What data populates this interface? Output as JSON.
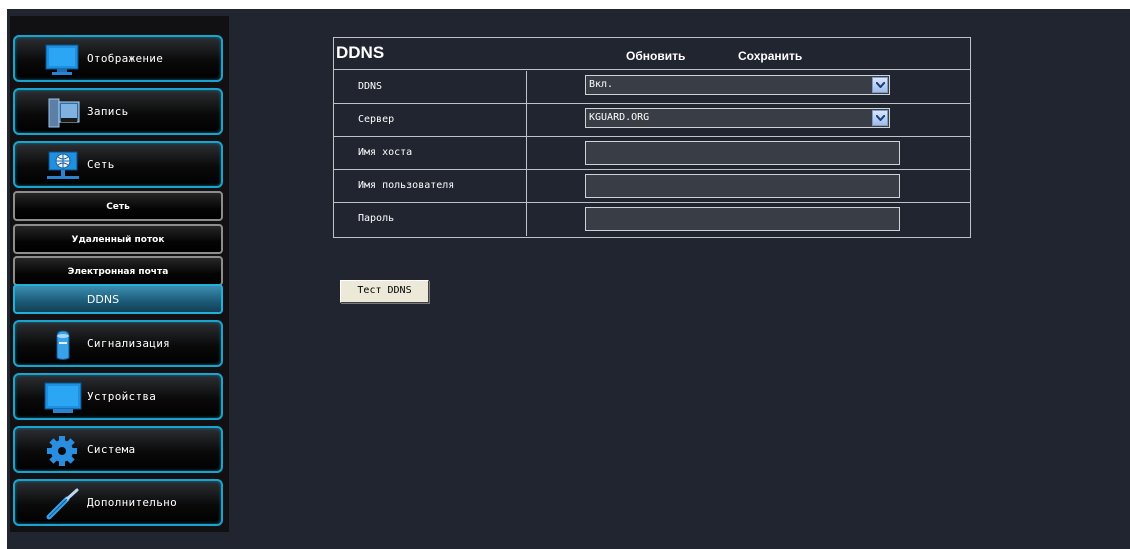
{
  "sidebar": {
    "items": [
      {
        "label": "Отображение",
        "icon": "monitor-icon"
      },
      {
        "label": "Запись",
        "icon": "film-icon"
      },
      {
        "label": "Сеть",
        "icon": "network-icon"
      },
      {
        "label": "Сигнализация",
        "icon": "alarm-icon"
      },
      {
        "label": "Устройства",
        "icon": "devices-icon"
      },
      {
        "label": "Система",
        "icon": "gear-icon"
      },
      {
        "label": "Дополнительно",
        "icon": "wrench-icon"
      }
    ],
    "subitems": [
      {
        "label": "Сеть"
      },
      {
        "label": "Удаленный поток"
      },
      {
        "label": "Электронная почта"
      },
      {
        "label": "DDNS",
        "active": true
      }
    ]
  },
  "main": {
    "title": "DDNS",
    "refresh_label": "Обновить",
    "save_label": "Сохранить",
    "rows": [
      {
        "label": "DDNS",
        "type": "select",
        "value": "Вкл."
      },
      {
        "label": "Сервер",
        "type": "select",
        "value": "KGUARD.ORG"
      },
      {
        "label": "Имя хоста",
        "type": "text",
        "value": ""
      },
      {
        "label": "Имя пользователя",
        "type": "text",
        "value": ""
      },
      {
        "label": "Пароль",
        "type": "password",
        "value": ""
      }
    ],
    "test_button_label": "Тест DDNS"
  },
  "colors": {
    "background": "#202530",
    "accent": "#1aa3cc",
    "active_item": "#2a7596"
  }
}
